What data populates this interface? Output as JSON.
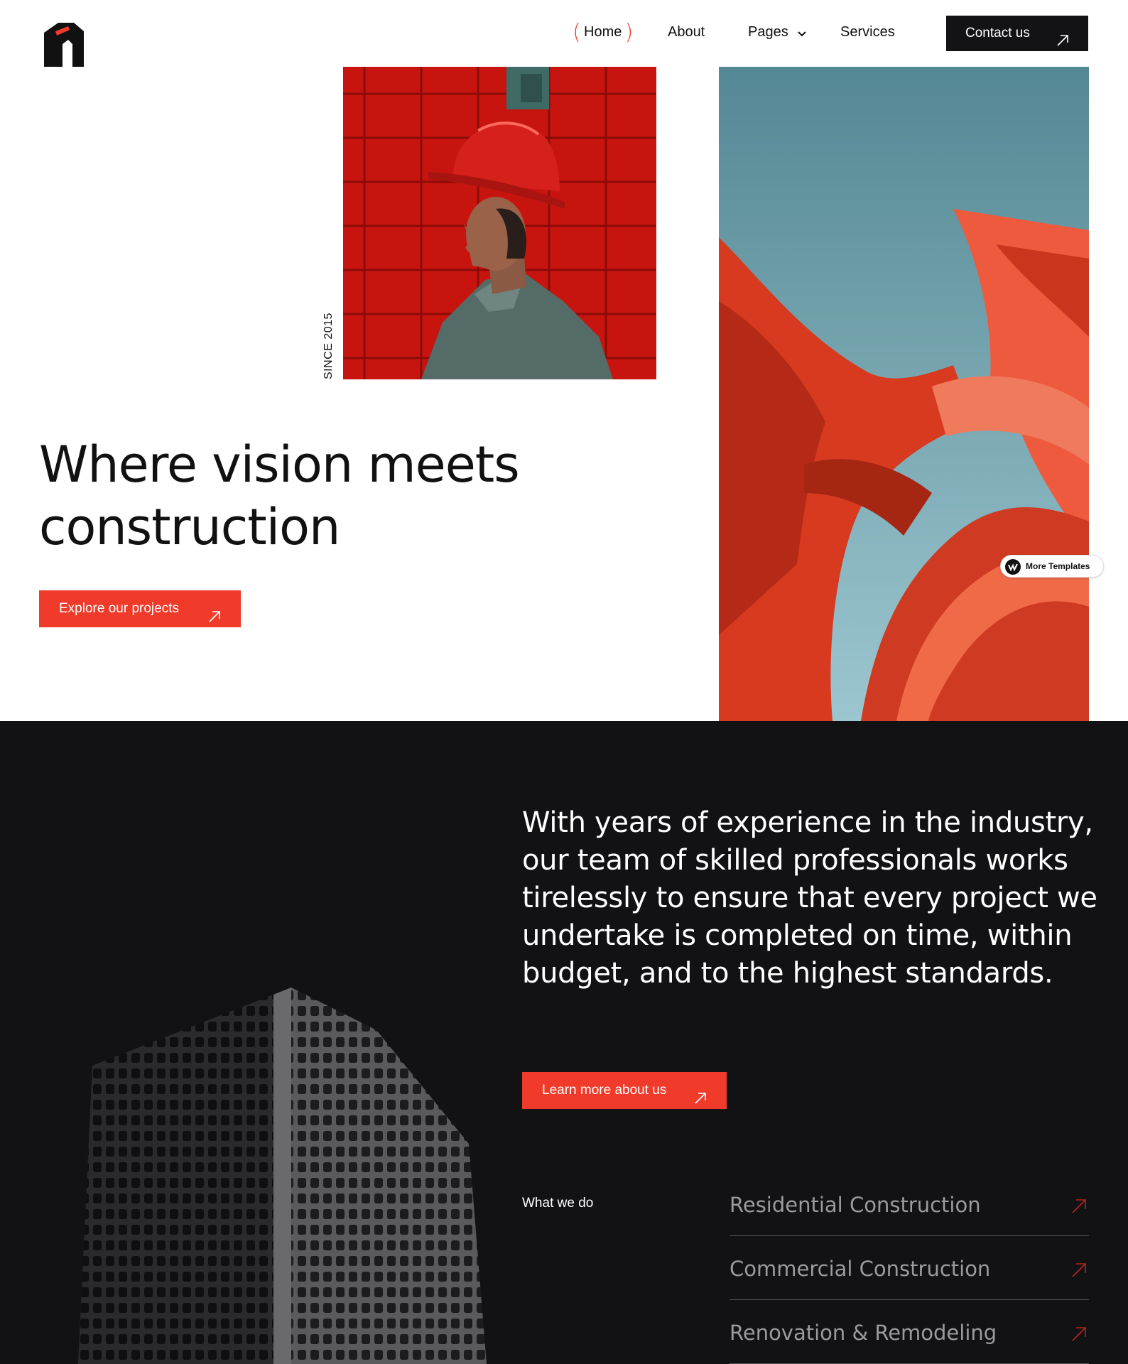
{
  "nav": {
    "home": "Home",
    "about": "About",
    "pages": "Pages",
    "services": "Services",
    "contact": "Contact us"
  },
  "hero": {
    "since": "SINCE 2015",
    "title_line1": "Where vision meets",
    "title_line2": "construction",
    "cta": "Explore our projects"
  },
  "badge": {
    "label": "More Templates"
  },
  "about": {
    "text": "With years of experience in the industry, our team of skilled professionals works tirelessly to ensure that every project we undertake is completed on time, within budget, and to the highest standards.",
    "cta": "Learn more about us"
  },
  "what_we_do": {
    "label": "What we do",
    "items": [
      {
        "label": "Residential Construction"
      },
      {
        "label": "Commercial Construction"
      },
      {
        "label": "Renovation & Remodeling"
      }
    ]
  },
  "colors": {
    "accent": "#f03a2a",
    "dark": "#121214",
    "button_dark": "#131316"
  },
  "icons": {
    "arrow": "arrow-up-right-icon",
    "chevron": "chevron-down-icon",
    "logo": "house-logo-icon"
  }
}
